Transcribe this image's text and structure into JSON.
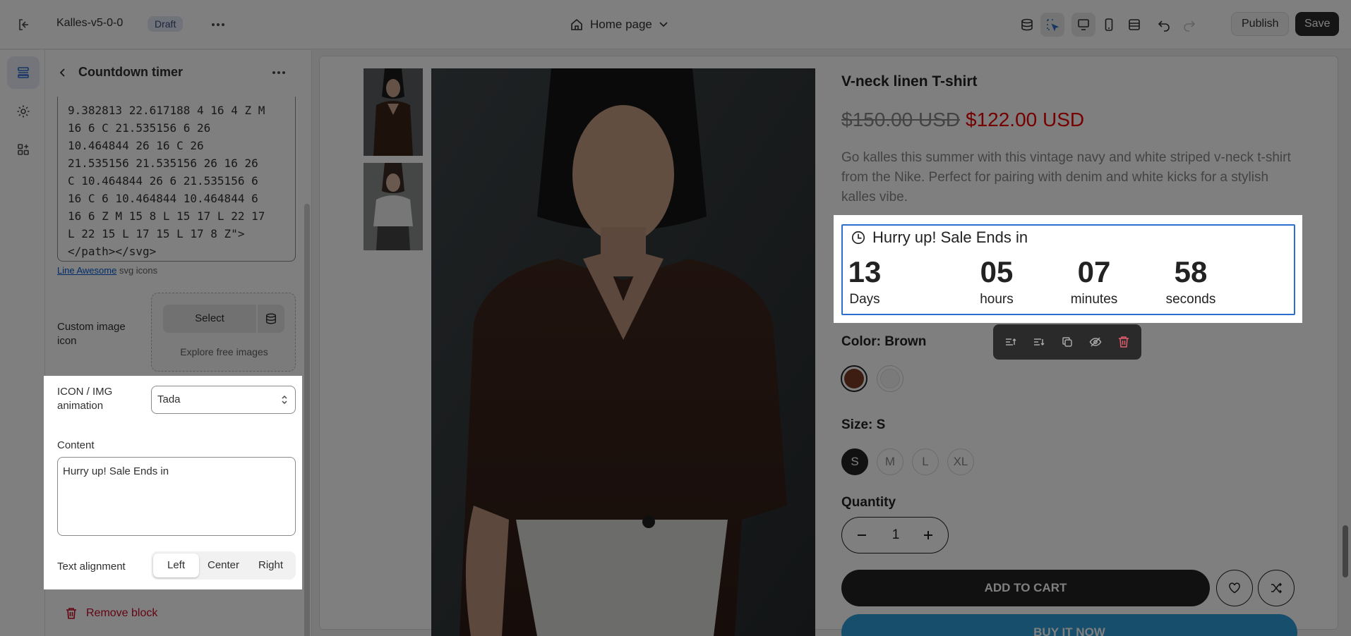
{
  "topbar": {
    "theme_name": "Kalles-v5-0-0",
    "status_badge": "Draft",
    "page_selector": "Home page",
    "publish_label": "Publish",
    "save_label": "Save",
    "icons": [
      "exit-icon",
      "more-horizontal-icon",
      "home-icon",
      "chevron-down-icon",
      "database-icon",
      "inspector-icon",
      "desktop-icon",
      "mobile-icon",
      "fullscreen-icon",
      "undo-icon",
      "redo-icon"
    ]
  },
  "rail": {
    "items": [
      "sections-icon",
      "settings-icon",
      "apps-icon"
    ],
    "active": "sections-icon"
  },
  "panel": {
    "title": "Countdown timer",
    "svg_code_lines": [
      "9.382813 22.617188 4 16 4 Z M",
      "16 6 C 21.535156 6 26",
      "10.464844 26 16 C 26",
      "21.535156 21.535156 26 16 26",
      "C 10.464844 26 6 21.535156 6",
      "16 C 6 10.464844 10.464844 6",
      "16 6 Z M 15 8 L 15 17 L 22 17",
      "L 22 15 L 17 15 L 17 8 Z\">",
      "</path></svg>"
    ],
    "icon_link_text": "Line Awesome",
    "icon_link_suffix": "svg icons",
    "custom_image_label": "Custom image icon",
    "select_button": "Select",
    "explore_link": "Explore free images",
    "animation_label": "ICON / IMG animation",
    "animation_value": "Tada",
    "content_label": "Content",
    "content_value": "Hurry up! Sale Ends in",
    "alignment_label": "Text alignment",
    "alignment_options": [
      "Left",
      "Center",
      "Right"
    ],
    "alignment_selected": "Left",
    "remove_block": "Remove block"
  },
  "preview": {
    "product_title": "V-neck linen T-shirt",
    "price_compare": "$150.00 USD",
    "price_sale": "$122.00 USD",
    "description": "Go kalles this summer with this vintage navy and white striped v-neck t-shirt from the Nike. Perfect for pairing with denim and white kicks for a stylish kalles vibe.",
    "countdown": {
      "heading": "Hurry up! Sale Ends in",
      "units": [
        {
          "value": "13",
          "label": "Days"
        },
        {
          "value": "05",
          "label": "hours"
        },
        {
          "value": "07",
          "label": "minutes"
        },
        {
          "value": "58",
          "label": "seconds"
        }
      ]
    },
    "block_toolbar": [
      "move-up-icon",
      "move-down-icon",
      "duplicate-icon",
      "hide-icon",
      "delete-icon"
    ],
    "color_label": "Color: Brown",
    "colors": [
      "#7a3a22",
      "#f5f5f5"
    ],
    "size_label": "Size: S",
    "sizes": [
      "S",
      "M",
      "L",
      "XL"
    ],
    "size_selected": "S",
    "quantity_label": "Quantity",
    "quantity_value": "1",
    "add_to_cart": "ADD TO CART",
    "buy_now": "BUY IT NOW"
  },
  "colors": {
    "accent_blue": "#2c6ecb",
    "sale_red": "#ec0101",
    "danger": "#c70a24"
  }
}
